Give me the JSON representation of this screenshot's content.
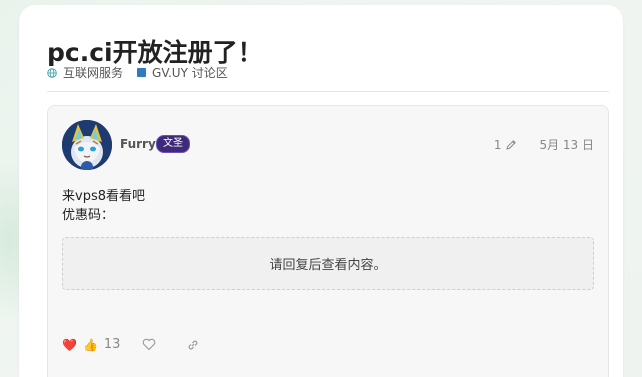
{
  "topic": {
    "title": "pc.ci开放注册了！",
    "tags": [
      {
        "icon": "globe-icon",
        "label": "互联网服务"
      },
      {
        "color": "#2f7bbd",
        "label": "GV.UY 讨论区"
      }
    ]
  },
  "post": {
    "username": "Furry",
    "badge": "文圣",
    "edit_count": "1",
    "date": "5月 13 日",
    "lines": [
      "来vps8看看吧",
      "优惠码："
    ],
    "hidden_notice": "请回复后查看内容。",
    "reactions": {
      "emojis": [
        "❤️",
        "👍"
      ],
      "count": "13"
    }
  },
  "colors": {
    "category": "#2f7bbd",
    "badge": "#3f2a7a",
    "accent_red": "#d93d3d"
  }
}
